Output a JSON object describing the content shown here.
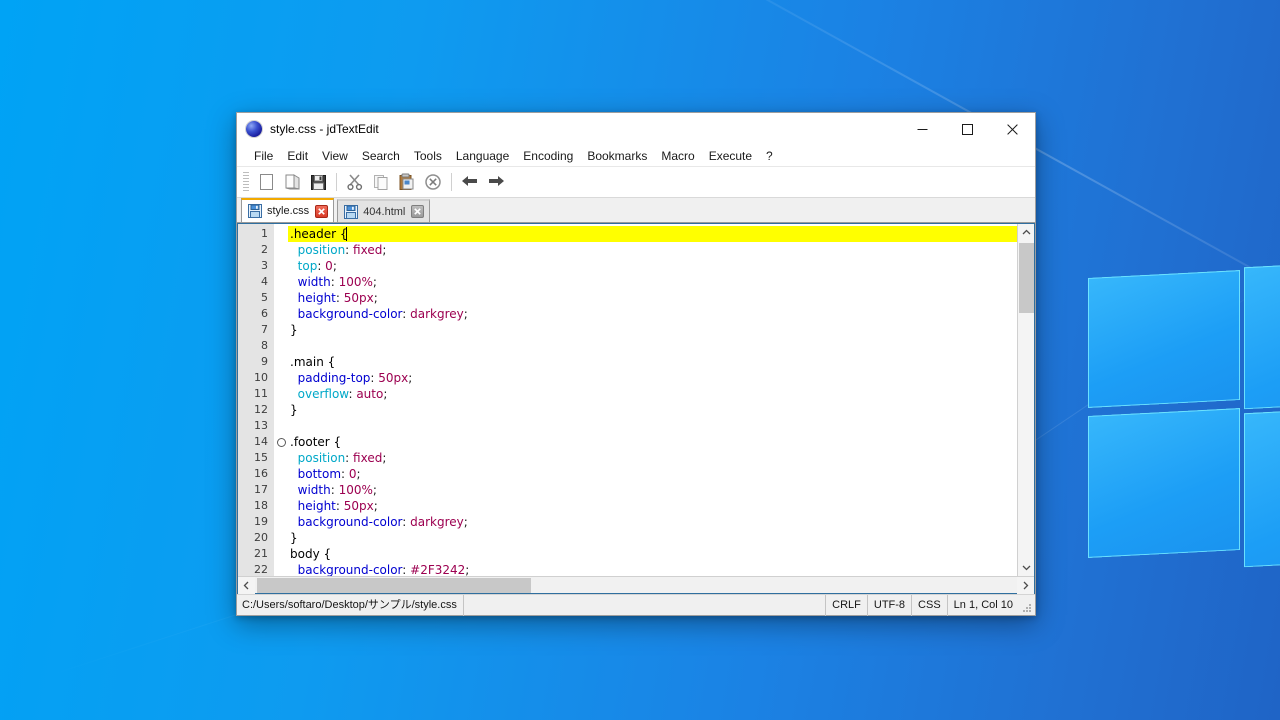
{
  "desktop": {
    "wallpaper_name": "windows-10-hero-wallpaper",
    "gradient_start": "#00A3F5",
    "gradient_end": "#1F64C6",
    "logo_pane_color": "#1C9EF6"
  },
  "window": {
    "title": "style.css - jdTextEdit",
    "app_icon": "blue-sphere-icon",
    "controls": {
      "minimize": "minimize-icon",
      "maximize": "maximize-icon",
      "close": "close-icon"
    }
  },
  "menu": {
    "items": [
      {
        "label": "File"
      },
      {
        "label": "Edit"
      },
      {
        "label": "View"
      },
      {
        "label": "Search"
      },
      {
        "label": "Tools"
      },
      {
        "label": "Language"
      },
      {
        "label": "Encoding"
      },
      {
        "label": "Bookmarks"
      },
      {
        "label": "Macro"
      },
      {
        "label": "Execute"
      },
      {
        "label": "?"
      }
    ]
  },
  "toolbar": {
    "buttons": [
      {
        "name": "new-file-icon",
        "tooltip": "New"
      },
      {
        "name": "open-file-icon",
        "tooltip": "Open"
      },
      {
        "name": "save-file-icon",
        "tooltip": "Save"
      },
      {
        "name": "cut-icon",
        "tooltip": "Cut"
      },
      {
        "name": "copy-icon",
        "tooltip": "Copy"
      },
      {
        "name": "paste-icon",
        "tooltip": "Paste"
      },
      {
        "name": "delete-icon",
        "tooltip": "Delete"
      },
      {
        "name": "undo-icon",
        "tooltip": "Undo"
      },
      {
        "name": "redo-icon",
        "tooltip": "Redo"
      }
    ]
  },
  "tabs": [
    {
      "label": "style.css",
      "icon": "floppy-disk-icon",
      "active": true,
      "close_style": "red"
    },
    {
      "label": "404.html",
      "icon": "floppy-disk-icon",
      "active": false,
      "close_style": "grey"
    }
  ],
  "editor": {
    "highlight_color": "#FFFF00",
    "gutter_color": "#E4E4E4",
    "fold_marker_line": 14,
    "caret": {
      "line": 1,
      "column": 10
    },
    "lines": [
      {
        "n": 1,
        "tokens": [
          {
            "t": ".header {",
            "c": "sel"
          }
        ]
      },
      {
        "n": 2,
        "tokens": [
          {
            "t": "  ",
            "c": "punct"
          },
          {
            "t": "position",
            "c": "prop1"
          },
          {
            "t": ": ",
            "c": "punct"
          },
          {
            "t": "fixed",
            "c": "val"
          },
          {
            "t": ";",
            "c": "punct"
          }
        ]
      },
      {
        "n": 3,
        "tokens": [
          {
            "t": "  ",
            "c": "punct"
          },
          {
            "t": "top",
            "c": "prop1"
          },
          {
            "t": ": ",
            "c": "punct"
          },
          {
            "t": "0",
            "c": "val"
          },
          {
            "t": ";",
            "c": "punct"
          }
        ]
      },
      {
        "n": 4,
        "tokens": [
          {
            "t": "  ",
            "c": "punct"
          },
          {
            "t": "width",
            "c": "prop2"
          },
          {
            "t": ": ",
            "c": "punct"
          },
          {
            "t": "100%",
            "c": "val"
          },
          {
            "t": ";",
            "c": "punct"
          }
        ]
      },
      {
        "n": 5,
        "tokens": [
          {
            "t": "  ",
            "c": "punct"
          },
          {
            "t": "height",
            "c": "prop2"
          },
          {
            "t": ": ",
            "c": "punct"
          },
          {
            "t": "50px",
            "c": "val"
          },
          {
            "t": ";",
            "c": "punct"
          }
        ]
      },
      {
        "n": 6,
        "tokens": [
          {
            "t": "  ",
            "c": "punct"
          },
          {
            "t": "background-color",
            "c": "prop2"
          },
          {
            "t": ": ",
            "c": "punct"
          },
          {
            "t": "darkgrey",
            "c": "val"
          },
          {
            "t": ";",
            "c": "punct"
          }
        ]
      },
      {
        "n": 7,
        "tokens": [
          {
            "t": "}",
            "c": "sel"
          }
        ]
      },
      {
        "n": 8,
        "tokens": []
      },
      {
        "n": 9,
        "tokens": [
          {
            "t": ".main {",
            "c": "sel"
          }
        ]
      },
      {
        "n": 10,
        "tokens": [
          {
            "t": "  ",
            "c": "punct"
          },
          {
            "t": "padding-top",
            "c": "prop2"
          },
          {
            "t": ": ",
            "c": "punct"
          },
          {
            "t": "50px",
            "c": "val"
          },
          {
            "t": ";",
            "c": "punct"
          }
        ]
      },
      {
        "n": 11,
        "tokens": [
          {
            "t": "  ",
            "c": "punct"
          },
          {
            "t": "overflow",
            "c": "prop1"
          },
          {
            "t": ": ",
            "c": "punct"
          },
          {
            "t": "auto",
            "c": "val"
          },
          {
            "t": ";",
            "c": "punct"
          }
        ]
      },
      {
        "n": 12,
        "tokens": [
          {
            "t": "}",
            "c": "sel"
          }
        ]
      },
      {
        "n": 13,
        "tokens": []
      },
      {
        "n": 14,
        "tokens": [
          {
            "t": ".footer {",
            "c": "sel"
          }
        ]
      },
      {
        "n": 15,
        "tokens": [
          {
            "t": "  ",
            "c": "punct"
          },
          {
            "t": "position",
            "c": "prop1"
          },
          {
            "t": ": ",
            "c": "punct"
          },
          {
            "t": "fixed",
            "c": "val"
          },
          {
            "t": ";",
            "c": "punct"
          }
        ]
      },
      {
        "n": 16,
        "tokens": [
          {
            "t": "  ",
            "c": "punct"
          },
          {
            "t": "bottom",
            "c": "prop2"
          },
          {
            "t": ": ",
            "c": "punct"
          },
          {
            "t": "0",
            "c": "val"
          },
          {
            "t": ";",
            "c": "punct"
          }
        ]
      },
      {
        "n": 17,
        "tokens": [
          {
            "t": "  ",
            "c": "punct"
          },
          {
            "t": "width",
            "c": "prop2"
          },
          {
            "t": ": ",
            "c": "punct"
          },
          {
            "t": "100%",
            "c": "val"
          },
          {
            "t": ";",
            "c": "punct"
          }
        ]
      },
      {
        "n": 18,
        "tokens": [
          {
            "t": "  ",
            "c": "punct"
          },
          {
            "t": "height",
            "c": "prop2"
          },
          {
            "t": ": ",
            "c": "punct"
          },
          {
            "t": "50px",
            "c": "val"
          },
          {
            "t": ";",
            "c": "punct"
          }
        ]
      },
      {
        "n": 19,
        "tokens": [
          {
            "t": "  ",
            "c": "punct"
          },
          {
            "t": "background-color",
            "c": "prop2"
          },
          {
            "t": ": ",
            "c": "punct"
          },
          {
            "t": "darkgrey",
            "c": "val"
          },
          {
            "t": ";",
            "c": "punct"
          }
        ]
      },
      {
        "n": 20,
        "tokens": [
          {
            "t": "}",
            "c": "sel"
          }
        ]
      },
      {
        "n": 21,
        "tokens": [
          {
            "t": "body {",
            "c": "sel"
          }
        ]
      },
      {
        "n": 22,
        "tokens": [
          {
            "t": "  ",
            "c": "punct"
          },
          {
            "t": "background-color",
            "c": "prop2"
          },
          {
            "t": ": ",
            "c": "punct"
          },
          {
            "t": "#2F3242",
            "c": "val"
          },
          {
            "t": ";",
            "c": "punct"
          }
        ]
      }
    ]
  },
  "status_bar": {
    "path": "C:/Users/softaro/Desktop/サンプル/style.css",
    "line_ending": "CRLF",
    "encoding": "UTF-8",
    "language": "CSS",
    "cursor": "Ln 1, Col 10"
  }
}
